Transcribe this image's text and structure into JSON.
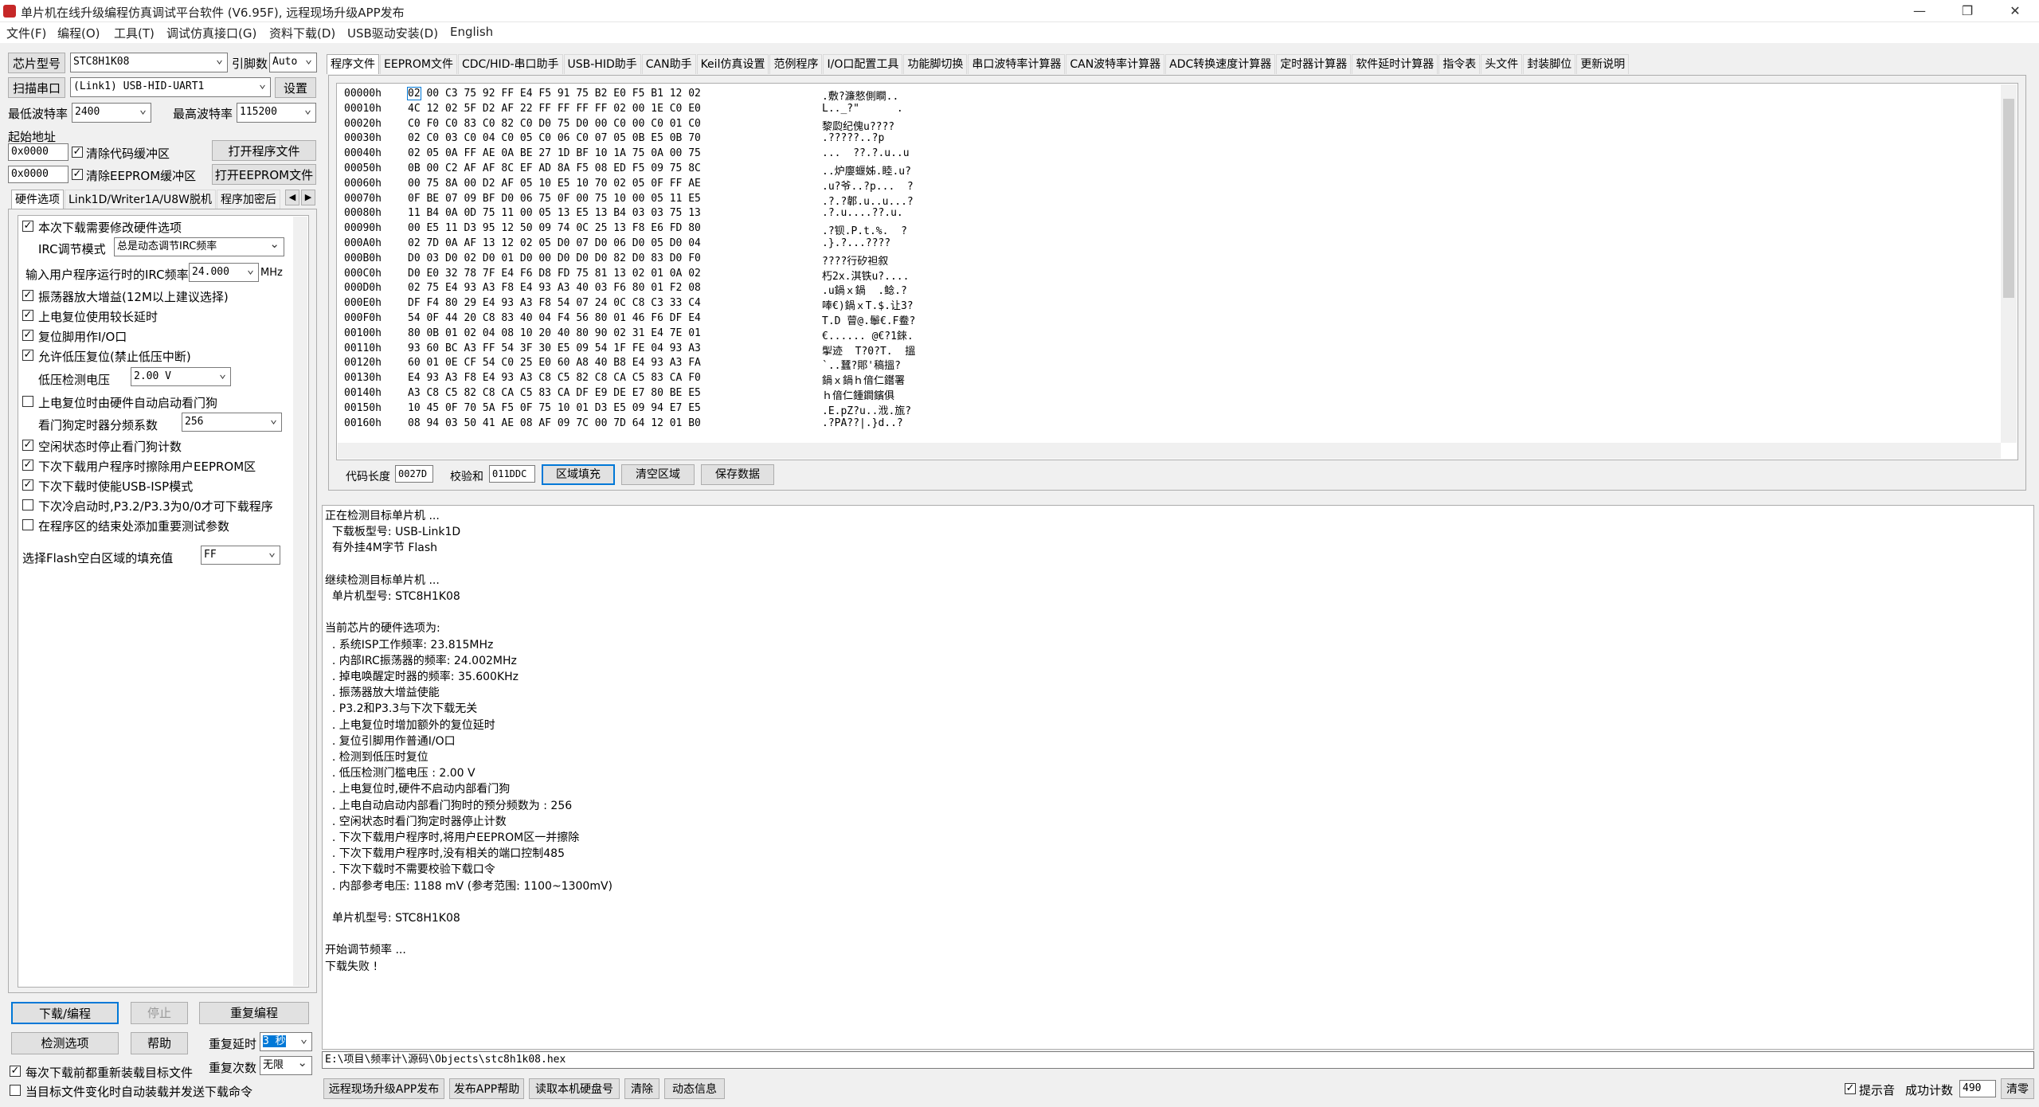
{
  "window": {
    "title": "单片机在线升级编程仿真调试平台软件 (V6.95F), 远程现场升级APP发布",
    "minimize": "—",
    "restore": "❐",
    "close": "✕"
  },
  "menu": [
    "文件(F)",
    "编程(O)",
    "工具(T)",
    "调试仿真接口(G)",
    "资料下载(D)",
    "USB驱动安装(D)",
    "English"
  ],
  "left": {
    "chip_label": "芯片型号",
    "chip_value": "STC8H1K08",
    "pins_label": "引脚数",
    "pins_value": "Auto",
    "scan_port": "扫描串口",
    "port_value": "(Link1) USB-HID-UART1",
    "settings": "设置",
    "min_baud_label": "最低波特率",
    "min_baud": "2400",
    "max_baud_label": "最高波特率",
    "max_baud": "115200",
    "start_addr": "起始地址",
    "addr1": "0x0000",
    "clear_code": "清除代码缓冲区",
    "open_prog": "打开程序文件",
    "addr2": "0x0000",
    "clear_eeprom": "清除EEPROM缓冲区",
    "open_eeprom": "打开EEPROM文件",
    "tabs": [
      "硬件选项",
      "Link1D/Writer1A/U8W脱机",
      "程序加密后"
    ],
    "options": {
      "opt1": "本次下载需要修改硬件选项",
      "irc_mode_label": "IRC调节模式",
      "irc_mode_value": "总是动态调节IRC频率",
      "irc_freq_label": "输入用户程序运行时的IRC频率",
      "irc_freq_value": "24.000",
      "irc_freq_unit": "MHz",
      "opt2": "振荡器放大增益(12M以上建议选择)",
      "opt3": "上电复位使用较长延时",
      "opt4": "复位脚用作I/O口",
      "opt5": "允许低压复位(禁止低压中断)",
      "lv_label": "低压检测电压",
      "lv_value": "2.00 V",
      "opt6": "上电复位时由硬件自动启动看门狗",
      "wdt_label": "看门狗定时器分频系数",
      "wdt_value": "256",
      "opt7": "空闲状态时停止看门狗计数",
      "opt8": "下次下载用户程序时擦除用户EEPROM区",
      "opt9": "下次下载时使能USB-ISP模式",
      "opt10": "下次冷启动时,P3.2/P3.3为0/0才可下载程序",
      "opt11": "在程序区的结束处添加重要测试参数",
      "fill_label": "选择Flash空白区域的填充值",
      "fill_value": "FF"
    },
    "download": "下载/编程",
    "stop": "停止",
    "reprogram": "重复编程",
    "check_options": "检测选项",
    "help": "帮助",
    "repeat_delay_label": "重复延时",
    "repeat_delay_value": "3 秒",
    "repeat_count_label": "重复次数",
    "repeat_count_value": "无限",
    "reload_before": "每次下载前都重新装载目标文件",
    "auto_send": "当目标文件变化时自动装载并发送下载命令"
  },
  "main_tabs": [
    "程序文件",
    "EEPROM文件",
    "CDC/HID-串口助手",
    "USB-HID助手",
    "CAN助手",
    "Keil仿真设置",
    "范例程序",
    "I/O口配置工具",
    "功能脚切换",
    "串口波特率计算器",
    "CAN波特率计算器",
    "ADC转换速度计算器",
    "定时器计算器",
    "软件延时计算器",
    "指令表",
    "头文件",
    "封装脚位",
    "更新说明"
  ],
  "hex_rows": [
    [
      "00000h",
      "02 00 C3 75 92 FF E4 F5 91 75 B2 E0 F5 B1 12 02",
      ".敷?濂憗側瞷.."
    ],
    [
      "00010h",
      "4C 12 02 5F D2 AF 22 FF FF FF FF 02 00 1E C0 E0",
      "L.._?\"      ."
    ],
    [
      "00020h",
      "C0 F0 C0 83 C0 82 C0 D0 75 D0 00 C0 00 C0 01 C0",
      "黎瓝纪傀u????"
    ],
    [
      "00030h",
      "02 C0 03 C0 04 C0 05 C0 06 C0 07 05 0B E5 0B 70",
      ".?????..?p"
    ],
    [
      "00040h",
      "02 05 0A FF AE 0A BE 27 1D BF 10 1A 75 0A 00 75",
      "...  ??.?.u..u"
    ],
    [
      "00050h",
      "0B 00 C2 AF AF 8C EF AD 8A F5 08 ED F5 09 75 8C",
      "..炉廮蝘姊.睦.u?"
    ],
    [
      "00060h",
      "00 75 8A 00 D2 AF 05 10 E5 10 70 02 05 0F FF AE",
      ".u?爷..?p...  ?"
    ],
    [
      "00070h",
      "0F BE 07 09 BF D0 06 75 0F 00 75 10 00 05 11 E5",
      ".?.?郼.u..u...?"
    ],
    [
      "00080h",
      "11 B4 0A 0D 75 11 00 05 13 E5 13 B4 03 03 75 13",
      ".?.u....??.u."
    ],
    [
      "00090h",
      "00 E5 11 D3 95 12 50 09 74 0C 25 13 F8 E6 FD 80",
      ".?钡.P.t.%.  ?"
    ],
    [
      "000A0h",
      "02 7D 0A AF 13 12 02 05 D0 07 D0 06 D0 05 D0 04",
      ".}.?...????"
    ],
    [
      "000B0h",
      "D0 03 D0 02 D0 01 D0 00 D0 D0 D0 82 D0 83 D0 F0",
      "????行矽袒叙"
    ],
    [
      "000C0h",
      "D0 E0 32 78 7F E4 F6 D8 FD 75 81 13 02 01 0A 02",
      "朽2x.淇铁u?...."
    ],
    [
      "000D0h",
      "02 75 E4 93 A3 F8 E4 93 A3 40 03 F6 80 01 F2 08",
      ".u鍋ｘ鍋  .鲶.?"
    ],
    [
      "000E0h",
      "DF F4 80 29 E4 93 A3 F8 54 07 24 0C C8 C3 33 C4",
      "唪€)鍋ｘT.$.让3?"
    ],
    [
      "000F0h",
      "54 0F 44 20 C8 83 40 04 F4 56 80 01 46 F6 DF E4",
      "T.D 萺@.鬡€.F鲞?"
    ],
    [
      "00100h",
      "80 0B 01 02 04 08 10 20 40 80 90 02 31 E4 7E 01",
      "€...... @€?1錸."
    ],
    [
      "00110h",
      "93 60 BC A3 FF 54 3F 30 E5 09 54 1F FE 04 93 A3",
      "揱迹  T?0?T.  搵"
    ],
    [
      "00120h",
      "60 01 0E CF 54 C0 25 E0 60 A8 40 B8 E4 93 A3 FA",
      "`..蠺?郥'稿搵?"
    ],
    [
      "00130h",
      "E4 93 A3 F8 E4 93 A3 C8 C5 82 C8 CA C5 83 CA F0",
      "鍋ｘ鍋ｈ偣仁鑙署"
    ],
    [
      "00140h",
      "A3 C8 C5 82 C8 CA C5 83 CA DF E9 DE E7 80 BE E5",
      "ｈ偣仁鍾鐧鑌俱"
    ],
    [
      "00150h",
      "10 45 0F 70 5A F5 0F 75 10 01 D3 E5 09 94 E7 E5",
      ".E.pZ?u..浌.旊?"
    ],
    [
      "00160h",
      "08 94 03 50 41 AE 08 AF 09 7C 00 7D 64 12 01 B0",
      ".?PA??|.}d..?"
    ]
  ],
  "hex_bottom": {
    "code_len_label": "代码长度",
    "code_len": "0027D",
    "checksum_label": "校验和",
    "checksum": "011DDC",
    "fill_area": "区域填充",
    "clear_area": "清空区域",
    "save_data": "保存数据"
  },
  "log_text": "正在检测目标单片机 ...\n  下载板型号: USB-Link1D\n  有外挂4M字节 Flash\n\n继续检测目标单片机 ...\n  单片机型号: STC8H1K08\n\n当前芯片的硬件选项为:\n  . 系统ISP工作频率: 23.815MHz\n  . 内部IRC振荡器的频率: 24.002MHz\n  . 掉电唤醒定时器的频率: 35.600KHz\n  . 振荡器放大增益使能\n  . P3.2和P3.3与下次下载无关\n  . 上电复位时增加额外的复位延时\n  . 复位引脚用作普通I/O口\n  . 检测到低压时复位\n  . 低压检测门槛电压 : 2.00 V\n  . 上电复位时,硬件不启动内部看门狗\n  . 上电自动启动内部看门狗时的预分频数为 : 256\n  . 空闲状态时看门狗定时器停止计数\n  . 下次下载用户程序时,将用户EEPROM区一并擦除\n  . 下次下载用户程序时,没有相关的端口控制485\n  . 下次下载时不需要校验下载口令\n  . 内部参考电压: 1188 mV (参考范围: 1100~1300mV)\n\n  单片机型号: STC8H1K08\n\n开始调节频率 ...\n下载失败 !",
  "file_path": "E:\\项目\\频率计\\源码\\Objects\\stc8h1k08.hex",
  "bottom_bar": {
    "remote_upgrade": "远程现场升级APP发布",
    "publish_help": "发布APP帮助",
    "read_disk": "读取本机硬盘号",
    "clear": "清除",
    "dynamic_info": "动态信息",
    "sound": "提示音",
    "success_label": "成功计数",
    "success_count": "490",
    "clear2": "清零"
  }
}
